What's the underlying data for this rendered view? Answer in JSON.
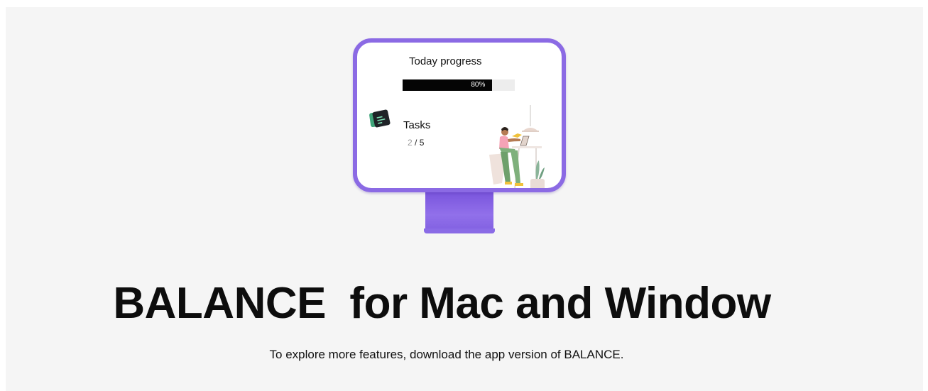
{
  "card": {
    "title": "Today progress",
    "progress": {
      "value": 0.8,
      "label": "80%"
    },
    "tasks": {
      "label": "Tasks",
      "done": "2",
      "separator": "/",
      "total": "5"
    }
  },
  "hero": {
    "title": "BALANCE  for Mac and Window",
    "subtitle": "To explore more features, download the app version of BALANCE."
  },
  "colors": {
    "monitor_accent": "#8b6ae4",
    "progress_fill": "#050505",
    "progress_track": "#ededed",
    "background": "#f5f5f5",
    "app_icon_accent": "#3fa57a"
  },
  "icons": {
    "app": "app-window-icon",
    "illustration": "person-at-laptop-illustration"
  }
}
